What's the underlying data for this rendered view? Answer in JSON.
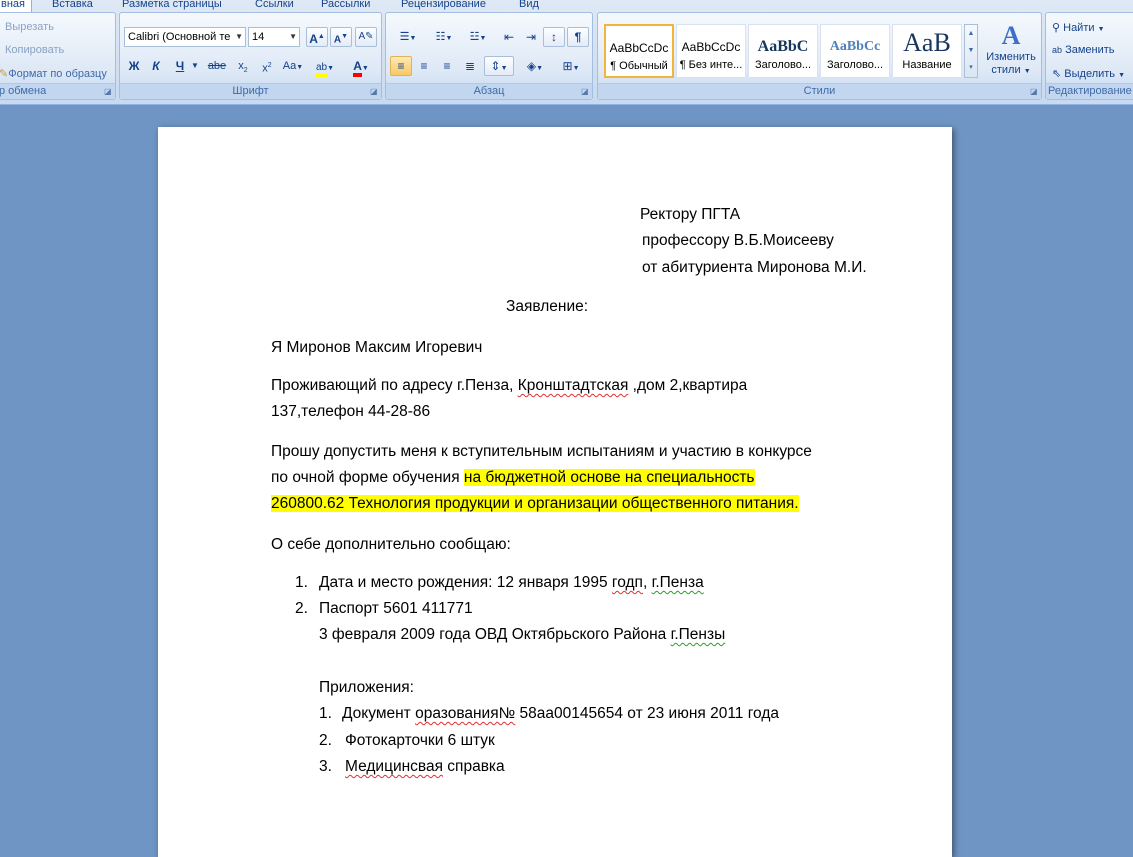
{
  "ribbon": {
    "tabs": [
      "вная",
      "Вставка",
      "Разметка страницы",
      "Ссылки",
      "Рассылки",
      "Рецензирование",
      "Вид"
    ],
    "clipboard": {
      "cut_label": "Вырезать",
      "copy_label": "Копировать",
      "format_painter_label": "Формат по образцу",
      "group_label": "р обмена"
    },
    "font": {
      "font_name": "Calibri (Основной те",
      "font_size": "14",
      "group_label": "Шрифт",
      "bold_glyph": "Ж",
      "italic_glyph": "К",
      "underline_glyph": "Ч",
      "strike_glyph": "abe",
      "case_glyph": "Aa",
      "highlight_color": "#ffff00",
      "font_color": "#ff0000"
    },
    "paragraph": {
      "group_label": "Абзац"
    },
    "styles": {
      "group_label": "Стили",
      "tiles": [
        {
          "sample": "AaBbCcDc",
          "name": "¶ Обычный"
        },
        {
          "sample": "AaBbCcDc",
          "name": "¶ Без инте..."
        },
        {
          "sample": "AaBbC",
          "name": "Заголово..."
        },
        {
          "sample": "AaBbCc",
          "name": "Заголово..."
        },
        {
          "sample": "AaB",
          "name": "Название"
        }
      ],
      "change_styles_label_1": "Изменить",
      "change_styles_label_2": "стили"
    },
    "editing": {
      "group_label": "Редактирование",
      "find_label": "Найти",
      "replace_label": "Заменить",
      "select_label": "Выделить"
    }
  },
  "document": {
    "header_lines": [
      "Ректору ПГТА",
      "профессору В.Б.Моисееву",
      "от абитуриента Миронова М.И."
    ],
    "title": "Заявление:",
    "line_name": "Я  Миронов Максим Игоревич",
    "addr_1_a": "Проживающий по адресу г.Пенза, ",
    "addr_1_b": "Кронштадтская",
    "addr_1_c": " ,дом 2,квартира",
    "addr_2": "137,телефон 44-28-86",
    "req_1": "Прошу  допустить меня  к вступительным испытаниям  и  участию в конкурсе",
    "req_2_a": "по очной  форме обучения ",
    "req_2_b": "на бюджетной основе  на специальность",
    "req_3": "260800.62 Технология продукции и организации общественного питания.",
    "about": "О себе дополнительно сообщаю:",
    "item1_num": "1.",
    "item1_a": "Дата и место рождения: 12 января 1995 ",
    "item1_b": "годп",
    "item1_c": ", ",
    "item1_d": "г.Пенза",
    "item2_num": "2.",
    "item2_a": "Паспорт  5601  411771",
    "item2_b_a": "3  февраля 2009 года ОВД Октябрьского Района ",
    "item2_b_b": "г.Пензы",
    "attachments_title": "Приложения:",
    "att1_num": "1.",
    "att1_a": "Документ ",
    "att1_b": "оразования№",
    "att1_c": " 58аа00145654  от 23 июня 2011 года",
    "att2_num": "2.",
    "att2": "Фотокарточки 6 штук",
    "att3_num": "3.",
    "att3_a": "Медицинсвая",
    "att3_b": " справка"
  }
}
